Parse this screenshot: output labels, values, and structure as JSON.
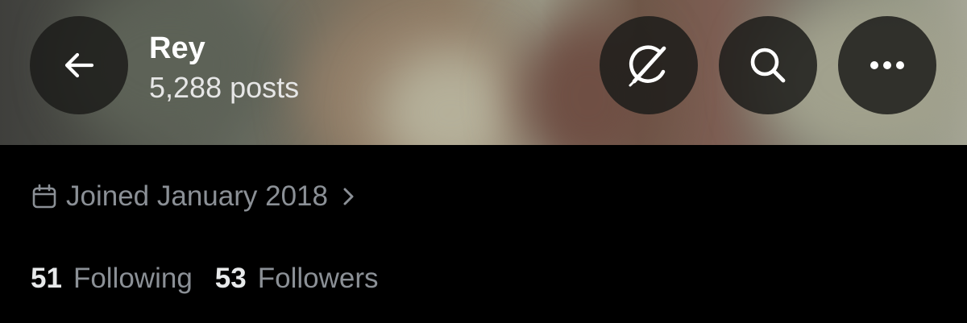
{
  "header": {
    "name": "Rey",
    "posts": "5,288 posts",
    "back_icon": "back-arrow-icon",
    "actions": [
      {
        "name": "grok-icon"
      },
      {
        "name": "search-icon"
      },
      {
        "name": "more-icon"
      }
    ]
  },
  "profile": {
    "joined": "Joined January 2018",
    "joined_icon": "calendar-icon",
    "following_count": "51",
    "following_label": "Following",
    "followers_count": "53",
    "followers_label": "Followers"
  },
  "colors": {
    "background": "#000000",
    "primary_text": "#e7e9ea",
    "secondary_text": "#8b9096",
    "button_bg": "#1c1c1a"
  }
}
